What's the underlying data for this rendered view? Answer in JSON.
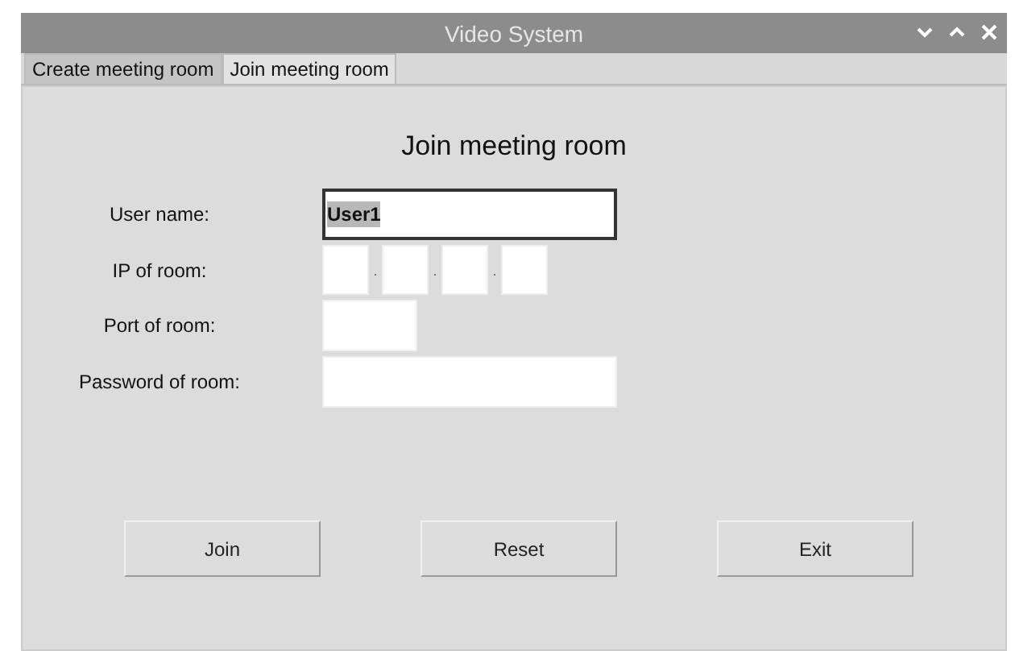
{
  "window": {
    "title": "Video System"
  },
  "tabs": [
    {
      "label": "Create meeting room",
      "selected": false
    },
    {
      "label": "Join meeting room",
      "selected": true
    }
  ],
  "heading": "Join meeting room",
  "form": [
    {
      "kind": "text",
      "label": "User name:",
      "value": "User1",
      "focused": true,
      "text_selected": true
    },
    {
      "kind": "ip",
      "label": "IP of room:",
      "separators": [
        ".",
        ".",
        "."
      ]
    },
    {
      "kind": "short",
      "label": "Port of room:"
    },
    {
      "kind": "text",
      "label": "Password of room:",
      "focused": false
    }
  ],
  "buttons": [
    "Join",
    "Reset",
    "Exit"
  ]
}
